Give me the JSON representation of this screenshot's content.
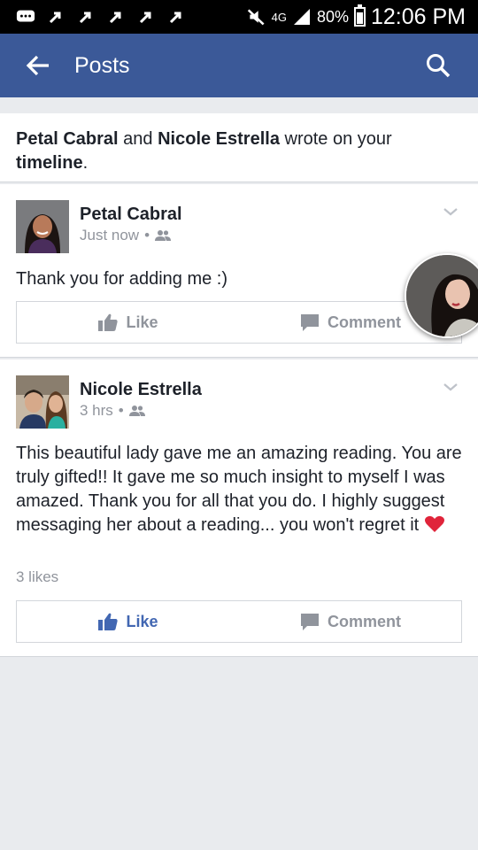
{
  "status_bar": {
    "network": "4G",
    "battery_text": "80%",
    "battery_level": 0.8,
    "time": "12:06 PM"
  },
  "header": {
    "title": "Posts",
    "back_icon": "arrow-left-icon",
    "search_icon": "search-icon",
    "color": "#3b5998"
  },
  "notice": {
    "name1": "Petal Cabral",
    "connector": "and",
    "name2": "Nicole Estrella",
    "text": "wrote on your",
    "bold_end": "timeline",
    "period": "."
  },
  "posts": [
    {
      "author": "Petal Cabral",
      "time": "Just now",
      "audience_icon": "friends-icon",
      "text": "Thank you for adding me :)",
      "like_label": "Like",
      "comment_label": "Comment",
      "liked": false
    },
    {
      "author": "Nicole Estrella",
      "time": "3 hrs",
      "audience_icon": "friends-icon",
      "text": "This beautiful lady gave me an amazing reading.  You are truly gifted!!  It gave me so much insight to myself I was amazed.  Thank you for all that you do.  I highly suggest messaging her about a reading... you won't regret it",
      "likes": "3 likes",
      "like_label": "Like",
      "comment_label": "Comment",
      "liked": true
    }
  ],
  "colors": {
    "like_active": "#4267b2",
    "muted": "#90949c",
    "heart": "#e0243a"
  }
}
